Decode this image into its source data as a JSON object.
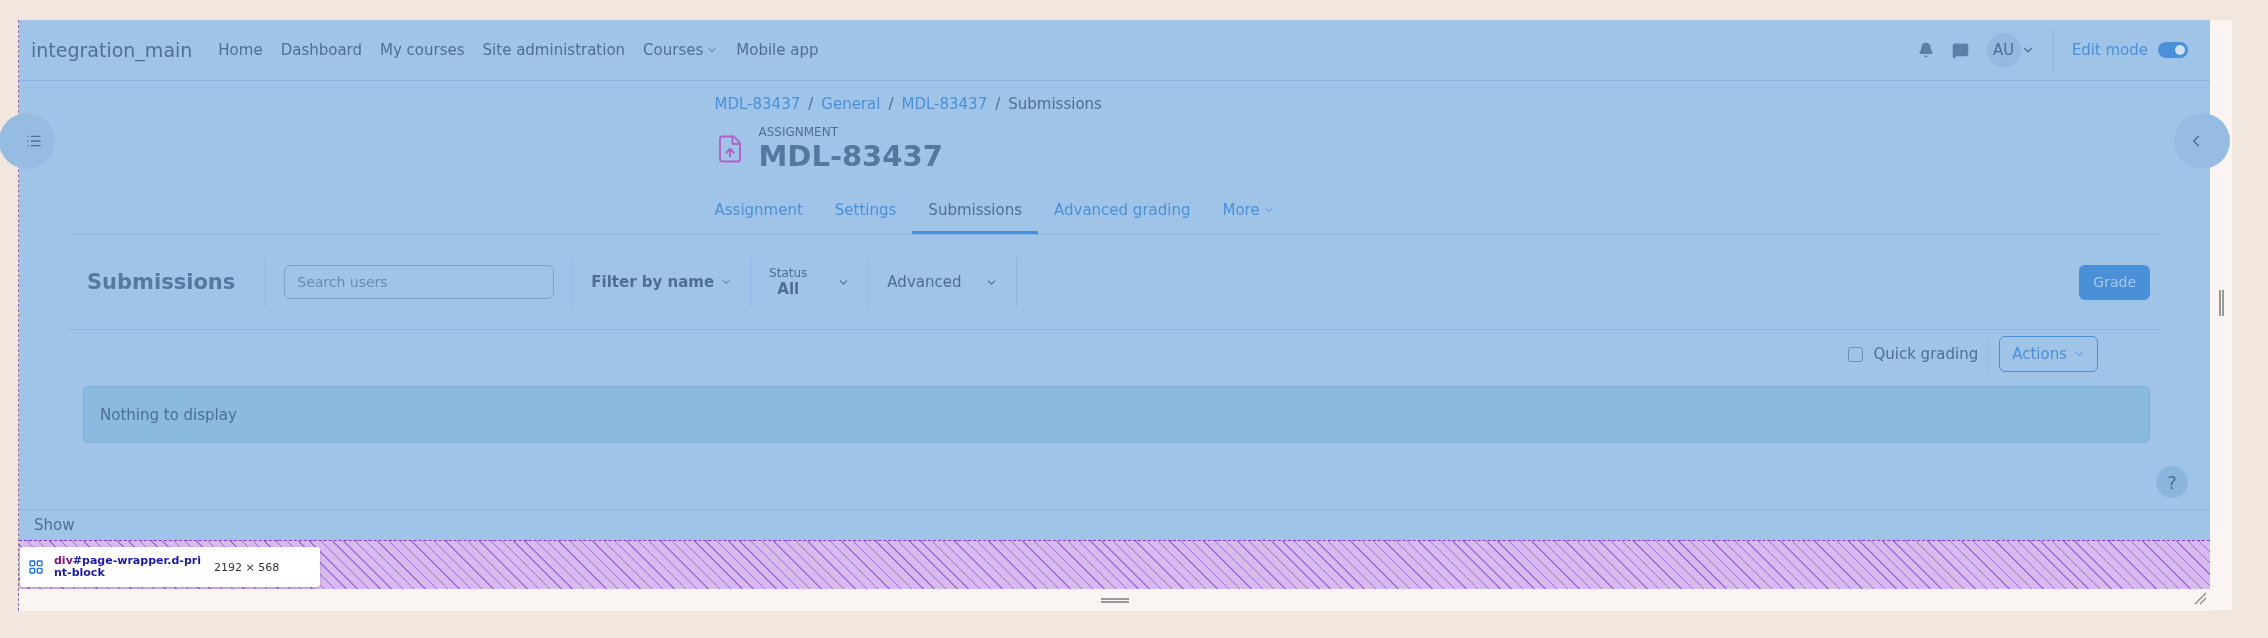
{
  "site_name": "integration_main",
  "nav": [
    {
      "label": "Home",
      "dropdown": false
    },
    {
      "label": "Dashboard",
      "dropdown": false
    },
    {
      "label": "My courses",
      "dropdown": false
    },
    {
      "label": "Site administration",
      "dropdown": false
    },
    {
      "label": "Courses",
      "dropdown": true
    },
    {
      "label": "Mobile app",
      "dropdown": false
    }
  ],
  "user": {
    "initials": "AU"
  },
  "edit_mode": {
    "label": "Edit mode",
    "on": true
  },
  "breadcrumb_separator": "/",
  "breadcrumb": [
    {
      "label": "MDL-83437",
      "link": true
    },
    {
      "label": "General",
      "link": true
    },
    {
      "label": "MDL-83437",
      "link": true
    },
    {
      "label": "Submissions",
      "link": false
    }
  ],
  "activity": {
    "type": "ASSIGNMENT",
    "title": "MDL-83437"
  },
  "tabs": [
    {
      "label": "Assignment",
      "selected": false,
      "dropdown": false
    },
    {
      "label": "Settings",
      "selected": false,
      "dropdown": false
    },
    {
      "label": "Submissions",
      "selected": true,
      "dropdown": false
    },
    {
      "label": "Advanced grading",
      "selected": false,
      "dropdown": false
    },
    {
      "label": "More",
      "selected": false,
      "dropdown": true
    }
  ],
  "toolbar": {
    "heading": "Submissions",
    "search": {
      "placeholder": "Search users"
    },
    "filter_by_name": "Filter by name",
    "status": {
      "label": "Status",
      "value": "All"
    },
    "advanced": "Advanced",
    "grade_button": "Grade"
  },
  "quick_grading": {
    "label": "Quick grading",
    "checked": false
  },
  "actions_button": "Actions",
  "empty_message": "Nothing to display",
  "help_button": "?",
  "footer": {
    "show": "Show"
  },
  "devtools_tooltip": {
    "tag": "div",
    "selector": "#page-wrapper.d-print-block",
    "size": "2192 × 568"
  }
}
